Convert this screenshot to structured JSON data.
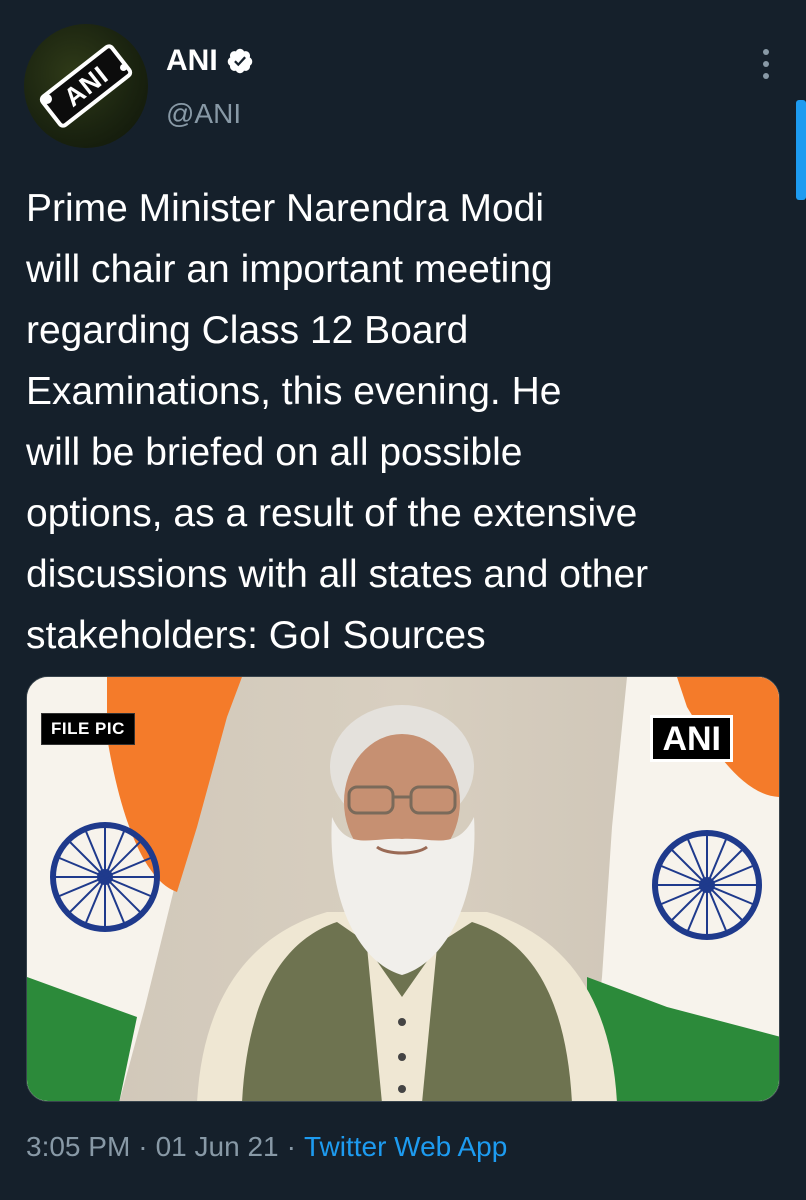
{
  "author": {
    "display_name": "ANI",
    "handle": "@ANI",
    "verified": true,
    "avatar_text": "ANI",
    "avatar_icon": "ani-logo"
  },
  "tweet": {
    "text_lines": [
      "Prime Minister Narendra Modi",
      "will chair an important meeting",
      "regarding Class 12 Board",
      "Examinations, this evening. He",
      "will be briefed on all possible",
      "options, as a result of the extensive",
      "discussions with all states and other",
      "stakeholders: GoI Sources"
    ]
  },
  "media": {
    "badge_left": "FILE PIC",
    "badge_right": "ANI"
  },
  "meta": {
    "time": "3:05 PM",
    "separator": "·",
    "date": "01 Jun 21",
    "source": "Twitter Web App"
  },
  "colors": {
    "background": "#15202b",
    "text": "#ffffff",
    "secondary": "#8899a6",
    "accent": "#1d9bf0",
    "flag_saffron": "#f47b2a",
    "flag_green": "#2c8a3a",
    "chakra": "#1f3a8c"
  },
  "icons": {
    "verified": "verified-badge-icon",
    "more": "more-vertical-icon"
  }
}
